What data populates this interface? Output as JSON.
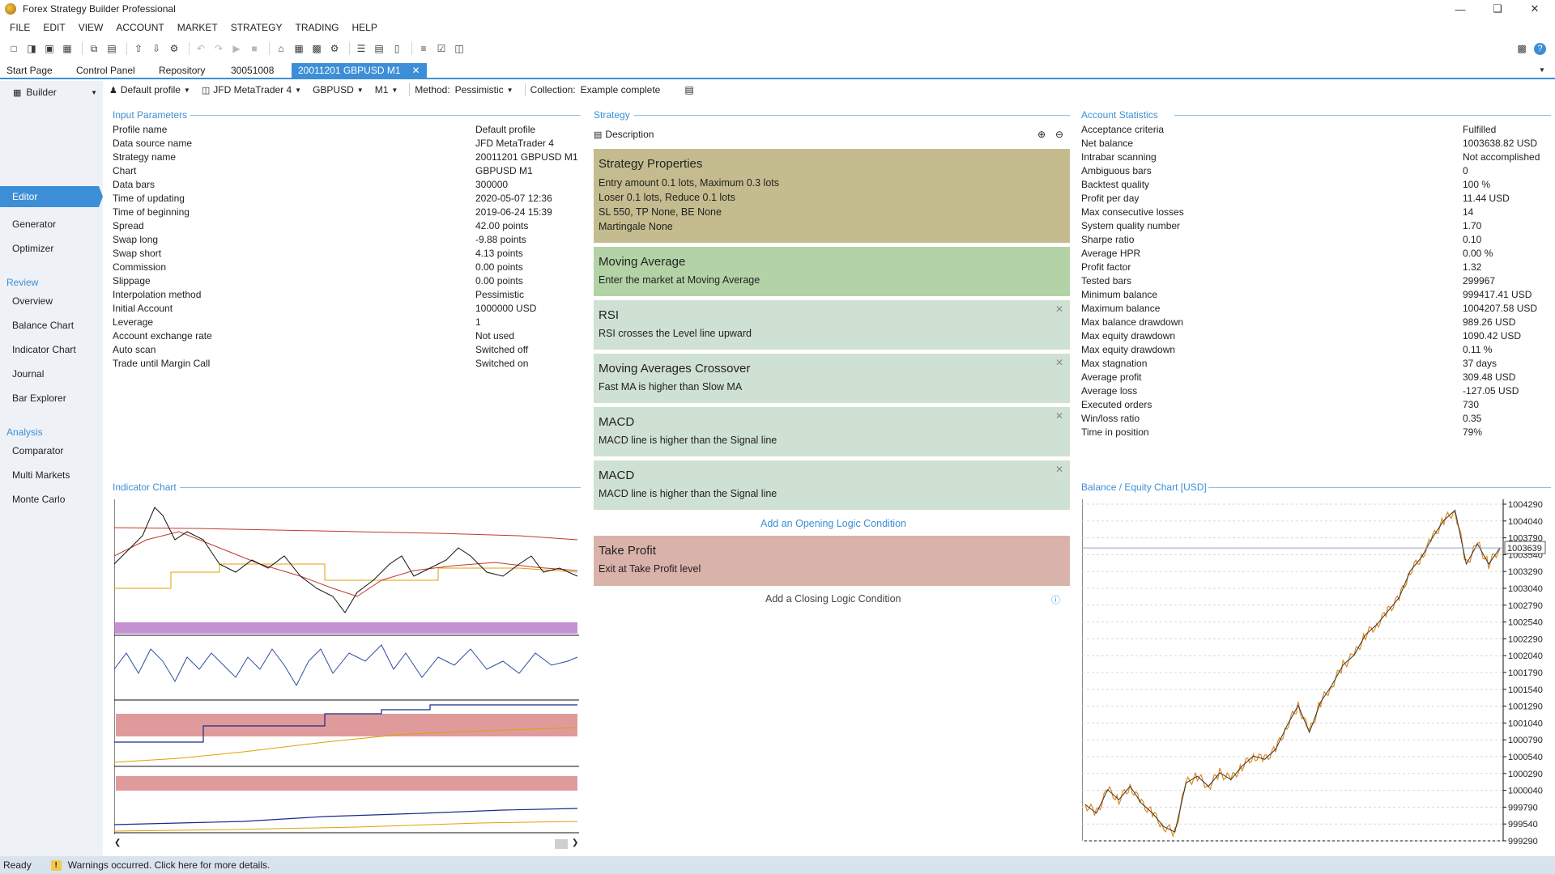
{
  "app": {
    "title": "Forex Strategy Builder Professional"
  },
  "menu": [
    "FILE",
    "EDIT",
    "VIEW",
    "ACCOUNT",
    "MARKET",
    "STRATEGY",
    "TRADING",
    "HELP"
  ],
  "tabs": [
    {
      "label": "Start Page"
    },
    {
      "label": "Control Panel"
    },
    {
      "label": "Repository"
    },
    {
      "label": "30051008"
    },
    {
      "label": "20011201 GBPUSD M1"
    }
  ],
  "sidebar": {
    "builder": "Builder",
    "editor": "Editor",
    "generator": "Generator",
    "optimizer": "Optimizer",
    "review_title": "Review",
    "review": [
      "Overview",
      "Balance Chart",
      "Indicator Chart",
      "Journal",
      "Bar Explorer"
    ],
    "analysis_title": "Analysis",
    "analysis": [
      "Comparator",
      "Multi Markets",
      "Monte Carlo"
    ]
  },
  "profile": {
    "profile": "Default profile",
    "broker": "JFD MetaTrader 4",
    "symbol": "GBPUSD",
    "period": "M1",
    "method_label": "Method:",
    "method": "Pessimistic",
    "collection_label": "Collection:",
    "collection": "Example complete"
  },
  "input_parameters": {
    "title": "Input Parameters",
    "rows": [
      [
        "Profile name",
        "Default profile"
      ],
      [
        "Data source name",
        "JFD MetaTrader 4"
      ],
      [
        "Strategy name",
        "20011201 GBPUSD M1"
      ],
      [
        "Chart",
        "GBPUSD M1"
      ],
      [
        "Data bars",
        "300000"
      ],
      [
        "Time of updating",
        "2020-05-07 12:36"
      ],
      [
        "Time of beginning",
        "2019-06-24 15:39"
      ],
      [
        "Spread",
        "42.00 points"
      ],
      [
        "Swap long",
        "-9.88 points"
      ],
      [
        "Swap short",
        "4.13 points"
      ],
      [
        "Commission",
        "0.00 points"
      ],
      [
        "Slippage",
        "0.00 points"
      ],
      [
        "Interpolation method",
        "Pessimistic"
      ],
      [
        "Initial Account",
        "1000000 USD"
      ],
      [
        "Leverage",
        "1"
      ],
      [
        "Account exchange rate",
        "Not used"
      ],
      [
        "Auto scan",
        "Switched off"
      ],
      [
        "Trade until Margin Call",
        "Switched on"
      ]
    ]
  },
  "strategy": {
    "title": "Strategy",
    "description": "Description",
    "properties": {
      "title": "Strategy Properties",
      "lines": [
        "Entry amount 0.1 lots, Maximum 0.3 lots",
        "Loser 0.1 lots, Reduce 0.1 lots",
        "SL 550,  TP None,  BE None",
        "Martingale None"
      ]
    },
    "open_slots": [
      {
        "title": "Moving Average",
        "line": "Enter the market at Moving Average"
      },
      {
        "title": "RSI",
        "line": "RSI crosses the Level line upward"
      },
      {
        "title": "Moving Averages Crossover",
        "line": "Fast MA is higher than Slow MA"
      },
      {
        "title": "MACD",
        "line": "MACD line is higher than the Signal line"
      },
      {
        "title": "MACD",
        "line": "MACD line is higher than the Signal line"
      }
    ],
    "add_opening": "Add an Opening Logic Condition",
    "close_slot": {
      "title": "Take Profit",
      "line": "Exit at Take Profit level"
    },
    "add_closing": "Add a Closing Logic Condition"
  },
  "account_statistics": {
    "title": "Account Statistics",
    "rows": [
      [
        "Acceptance criteria",
        "Fulfilled"
      ],
      [
        "Net balance",
        "1003638.82 USD"
      ],
      [
        "Intrabar scanning",
        "Not accomplished"
      ],
      [
        "Ambiguous bars",
        "0"
      ],
      [
        "Backtest quality",
        "100 %"
      ],
      [
        "Profit per day",
        "11.44 USD"
      ],
      [
        "Max consecutive losses",
        "14"
      ],
      [
        "System quality number",
        "1.70"
      ],
      [
        "Sharpe ratio",
        "0.10"
      ],
      [
        "Average HPR",
        "0.00 %"
      ],
      [
        "Profit factor",
        "1.32"
      ],
      [
        "Tested bars",
        "299967"
      ],
      [
        "Minimum balance",
        "999417.41 USD"
      ],
      [
        "Maximum balance",
        "1004207.58 USD"
      ],
      [
        "Max balance drawdown",
        "989.26 USD"
      ],
      [
        "Max equity drawdown",
        "1090.42 USD"
      ],
      [
        "Max equity drawdown",
        "0.11 %"
      ],
      [
        "Max stagnation",
        "37 days"
      ],
      [
        "Average profit",
        "309.48 USD"
      ],
      [
        "Average loss",
        "-127.05 USD"
      ],
      [
        "Executed orders",
        "730"
      ],
      [
        "Win/loss ratio",
        "0.35"
      ],
      [
        "Time in position",
        "79%"
      ]
    ]
  },
  "indicator_chart": {
    "title": "Indicator Chart"
  },
  "chart_data": {
    "type": "line",
    "title": "Balance / Equity Chart [USD]",
    "y_ticks": [
      1004290,
      1004040,
      1003790,
      1003540,
      1003290,
      1003040,
      1002790,
      1002540,
      1002290,
      1002040,
      1001790,
      1001540,
      1001290,
      1001040,
      1000790,
      1000540,
      1000290,
      1000040,
      999790,
      999540,
      999290
    ],
    "current_value": "1003639",
    "ylim": [
      999290,
      1004290
    ],
    "series": [
      {
        "values": [
          999830,
          999700,
          1000050,
          999900,
          1000100,
          999850,
          999700,
          999500,
          999420,
          1000150,
          1000250,
          1000100,
          1000300,
          1000200,
          1000400,
          1000550,
          1000500,
          1000650,
          1001000,
          1001300,
          1000900,
          1001350,
          1001600,
          1001900,
          1002050,
          1002350,
          1002500,
          1002700,
          1002900,
          1003300,
          1003500,
          1003800,
          1004050,
          1004200,
          1003400,
          1003700,
          1003400,
          1003640
        ]
      }
    ]
  },
  "statusbar": {
    "ready": "Ready",
    "warning": "Warnings occurred. Click here for more details."
  }
}
